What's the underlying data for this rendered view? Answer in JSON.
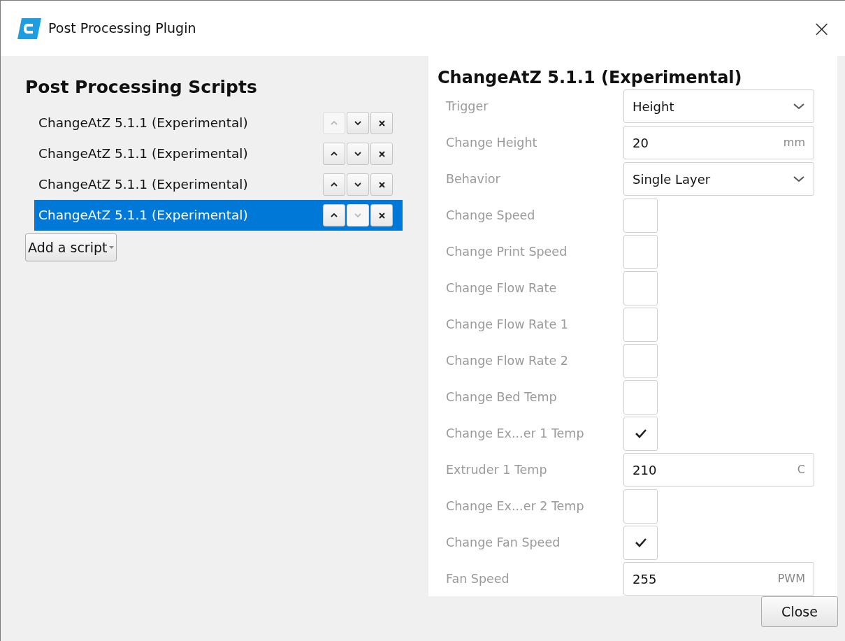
{
  "window": {
    "title": "Post Processing Plugin",
    "close": "×"
  },
  "scripts_panel": {
    "heading": "Post Processing Scripts",
    "scripts": [
      {
        "name": "ChangeAtZ 5.1.1 (Experimental)",
        "selected": false,
        "up_disabled": true,
        "down_disabled": false
      },
      {
        "name": "ChangeAtZ 5.1.1 (Experimental)",
        "selected": false,
        "up_disabled": false,
        "down_disabled": false
      },
      {
        "name": "ChangeAtZ 5.1.1 (Experimental)",
        "selected": false,
        "up_disabled": false,
        "down_disabled": false
      },
      {
        "name": "ChangeAtZ 5.1.1 (Experimental)",
        "selected": true,
        "up_disabled": false,
        "down_disabled": true
      }
    ],
    "add_button": "Add a script"
  },
  "settings_panel": {
    "heading": "ChangeAtZ 5.1.1 (Experimental)",
    "settings": [
      {
        "kind": "dropdown",
        "label": "Trigger",
        "value": "Height"
      },
      {
        "kind": "number",
        "label": "Change Height",
        "value": "20",
        "unit": "mm"
      },
      {
        "kind": "dropdown",
        "label": "Behavior",
        "value": "Single Layer"
      },
      {
        "kind": "checkbox",
        "label": "Change Speed",
        "checked": false
      },
      {
        "kind": "checkbox",
        "label": "Change Print Speed",
        "checked": false
      },
      {
        "kind": "checkbox",
        "label": "Change Flow Rate",
        "checked": false
      },
      {
        "kind": "checkbox",
        "label": "Change Flow Rate 1",
        "checked": false
      },
      {
        "kind": "checkbox",
        "label": "Change Flow Rate 2",
        "checked": false
      },
      {
        "kind": "checkbox",
        "label": "Change Bed Temp",
        "checked": false
      },
      {
        "kind": "checkbox",
        "label": "Change Ex...er 1 Temp",
        "checked": true
      },
      {
        "kind": "number",
        "label": "Extruder 1 Temp",
        "value": "210",
        "unit": "C"
      },
      {
        "kind": "checkbox",
        "label": "Change Ex...er 2 Temp",
        "checked": false
      },
      {
        "kind": "checkbox",
        "label": "Change Fan Speed",
        "checked": true
      },
      {
        "kind": "number",
        "label": "Fan Speed",
        "value": "255",
        "unit": "PWM"
      }
    ]
  },
  "footer": {
    "close_button": "Close"
  }
}
